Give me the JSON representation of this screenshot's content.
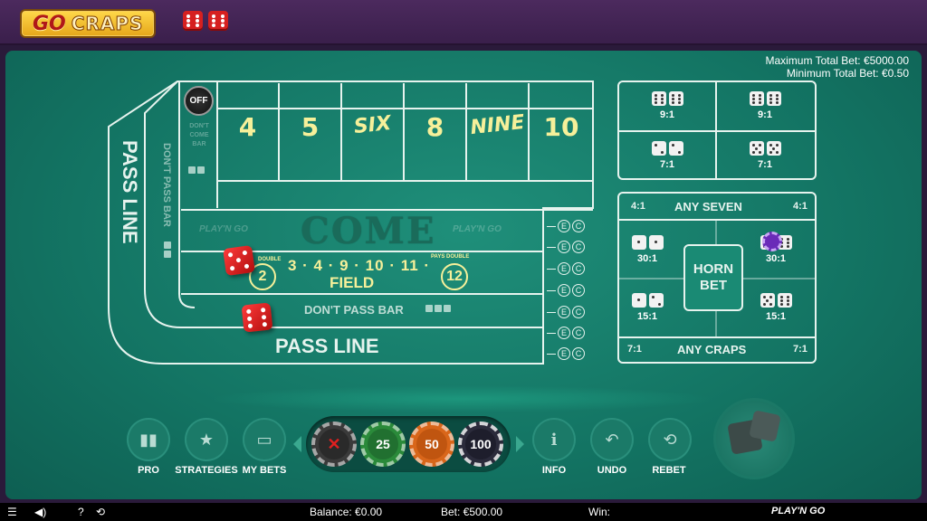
{
  "logo": {
    "go": "GO",
    "craps": "CRAPS"
  },
  "limits": {
    "max": "Maximum Total Bet: €5000.00",
    "min": "Minimum Total Bet: €0.50"
  },
  "table": {
    "off": "OFF",
    "dont_come_bar": "DON'T\nCOME\nBAR",
    "pass_line_vertical": "PASS LINE",
    "dont_pass_bar_vertical": "DON'T PASS BAR",
    "numbers": [
      "4",
      "5",
      "SIX",
      "8",
      "NINE",
      "10"
    ],
    "come": "COME",
    "come_logo": "PLAY'N GO",
    "field_numbers": "3 · 4 · 9 · 10 · 11 ·",
    "field_left": "2",
    "field_right": "12",
    "field_double": "DOUBLE",
    "field_pays_double": "PAYS DOUBLE",
    "field": "FIELD",
    "dont_pass_bar": "DON'T PASS BAR",
    "pass_line": "PASS LINE",
    "ec_e": "E",
    "ec_c": "C"
  },
  "hardways": [
    {
      "odds": "9:1"
    },
    {
      "odds": "9:1"
    },
    {
      "odds": "7:1"
    },
    {
      "odds": "7:1"
    }
  ],
  "props": {
    "any_seven": "ANY SEVEN",
    "any_seven_left": "4:1",
    "any_seven_right": "4:1",
    "horn_bet": "HORN BET",
    "cells": [
      "30:1",
      "30:1",
      "15:1",
      "15:1"
    ],
    "any_craps": "ANY CRAPS",
    "any_craps_left": "7:1",
    "any_craps_right": "7:1"
  },
  "controls": {
    "pro": "PRO",
    "strategies": "STRATEGIES",
    "my_bets": "MY BETS",
    "info": "INFO",
    "undo": "UNDO",
    "rebet": "REBET"
  },
  "chips": [
    "25",
    "50",
    "100"
  ],
  "chip_colors": {
    "25": "#2a8a3a",
    "50": "#d9661a",
    "100": "#2b2b3b",
    "clear": "#3a3a3a"
  },
  "footer": {
    "help": "?",
    "balance": "Balance: €0.00",
    "bet": "Bet: €500.00",
    "win": "Win:",
    "brand": "PLAY'N GO"
  }
}
